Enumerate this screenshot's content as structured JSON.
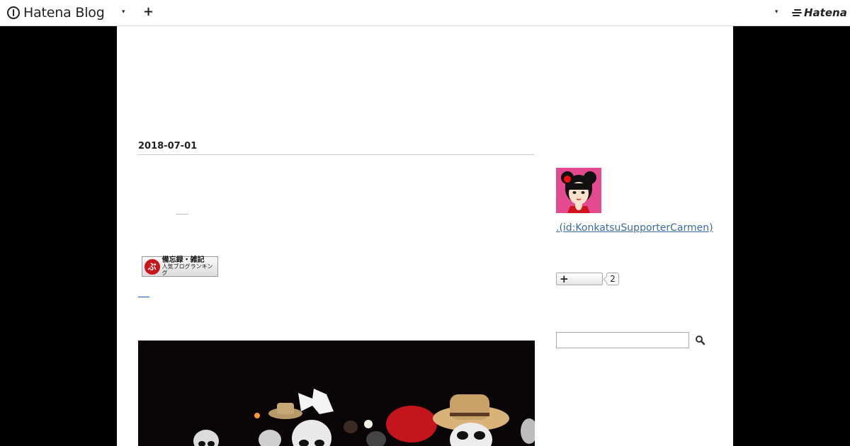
{
  "header": {
    "brand": "Hatena Blog",
    "hatena": "Hatena",
    "plus_label": "+",
    "caret": "▾"
  },
  "entry": {
    "date": "2018-07-01",
    "ranking_banner": {
      "line1": "備忘録・雑記",
      "line2": "人気ブログランキング",
      "mark": "ぶ"
    }
  },
  "sidebar": {
    "author_link": ".(id:KonkatsuSupporterCarmen)",
    "subscribe_label": "+",
    "subscriber_count": "2",
    "search": {
      "value": "",
      "placeholder": ""
    }
  }
}
